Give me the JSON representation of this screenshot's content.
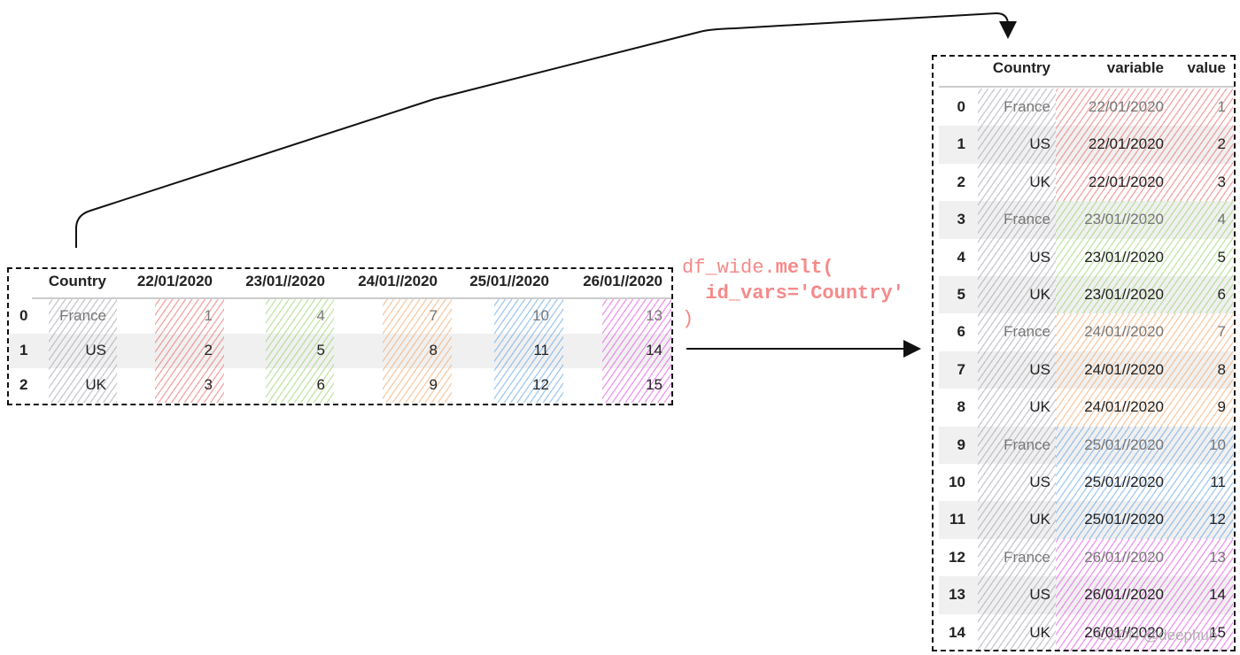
{
  "colors": {
    "country": "#9a9aa8",
    "dates": [
      "#e85c5c",
      "#8fcf60",
      "#f0a060",
      "#5a9ae0",
      "#e040e0"
    ]
  },
  "wide_table": {
    "columns": [
      "",
      "Country",
      "22/01/2020",
      "23/01//2020",
      "24/01//2020",
      "25/01//2020",
      "26/01//2020"
    ],
    "rows": [
      [
        "0",
        "France",
        "1",
        "4",
        "7",
        "10",
        "13"
      ],
      [
        "1",
        "US",
        "2",
        "5",
        "8",
        "11",
        "14"
      ],
      [
        "2",
        "UK",
        "3",
        "6",
        "9",
        "12",
        "15"
      ]
    ]
  },
  "code": {
    "obj": "df_wide.",
    "method": "melt(",
    "arg": "id_vars='Country'",
    "close": ")"
  },
  "long_table": {
    "columns": [
      "",
      "Country",
      "variable",
      "value"
    ],
    "rows": [
      [
        "0",
        "France",
        "22/01/2020",
        "1"
      ],
      [
        "1",
        "US",
        "22/01/2020",
        "2"
      ],
      [
        "2",
        "UK",
        "22/01/2020",
        "3"
      ],
      [
        "3",
        "France",
        "23/01//2020",
        "4"
      ],
      [
        "4",
        "US",
        "23/01//2020",
        "5"
      ],
      [
        "5",
        "UK",
        "23/01//2020",
        "6"
      ],
      [
        "6",
        "France",
        "24/01//2020",
        "7"
      ],
      [
        "7",
        "US",
        "24/01//2020",
        "8"
      ],
      [
        "8",
        "UK",
        "24/01//2020",
        "9"
      ],
      [
        "9",
        "France",
        "25/01//2020",
        "10"
      ],
      [
        "10",
        "US",
        "25/01//2020",
        "11"
      ],
      [
        "11",
        "UK",
        "25/01//2020",
        "12"
      ],
      [
        "12",
        "France",
        "26/01//2020",
        "13"
      ],
      [
        "13",
        "US",
        "26/01//2020",
        "14"
      ],
      [
        "14",
        "UK",
        "26/01//2020",
        "15"
      ]
    ]
  },
  "watermark": "CSDN @deephub"
}
